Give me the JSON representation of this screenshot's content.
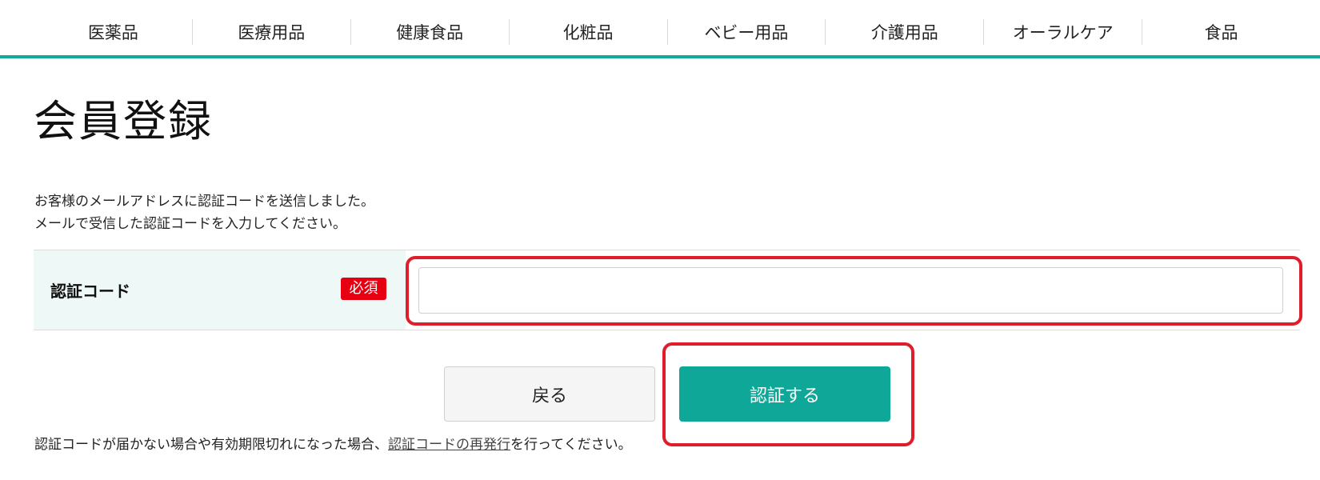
{
  "nav": {
    "items": [
      "医薬品",
      "医療用品",
      "健康食品",
      "化粧品",
      "ベビー用品",
      "介護用品",
      "オーラルケア",
      "食品"
    ]
  },
  "page": {
    "title": "会員登録",
    "lead_line1": "お客様のメールアドレスに認証コードを送信しました。",
    "lead_line2": "メールで受信した認証コードを入力してください。"
  },
  "form": {
    "code_label": "認証コード",
    "required_badge": "必須",
    "code_value": "",
    "code_placeholder": ""
  },
  "buttons": {
    "back_label": "戻る",
    "verify_label": "認証する"
  },
  "note": {
    "text_before": "認証コードが届かない場合や有効期限切れになった場合、",
    "link_text": "認証コードの再発行",
    "text_after": "を行ってください。"
  },
  "colors": {
    "accent": "#12a99a",
    "primary_button": "#0fa898",
    "required": "#e60012",
    "highlight": "#e01e2b",
    "label_cell_bg": "#eef8f6"
  }
}
